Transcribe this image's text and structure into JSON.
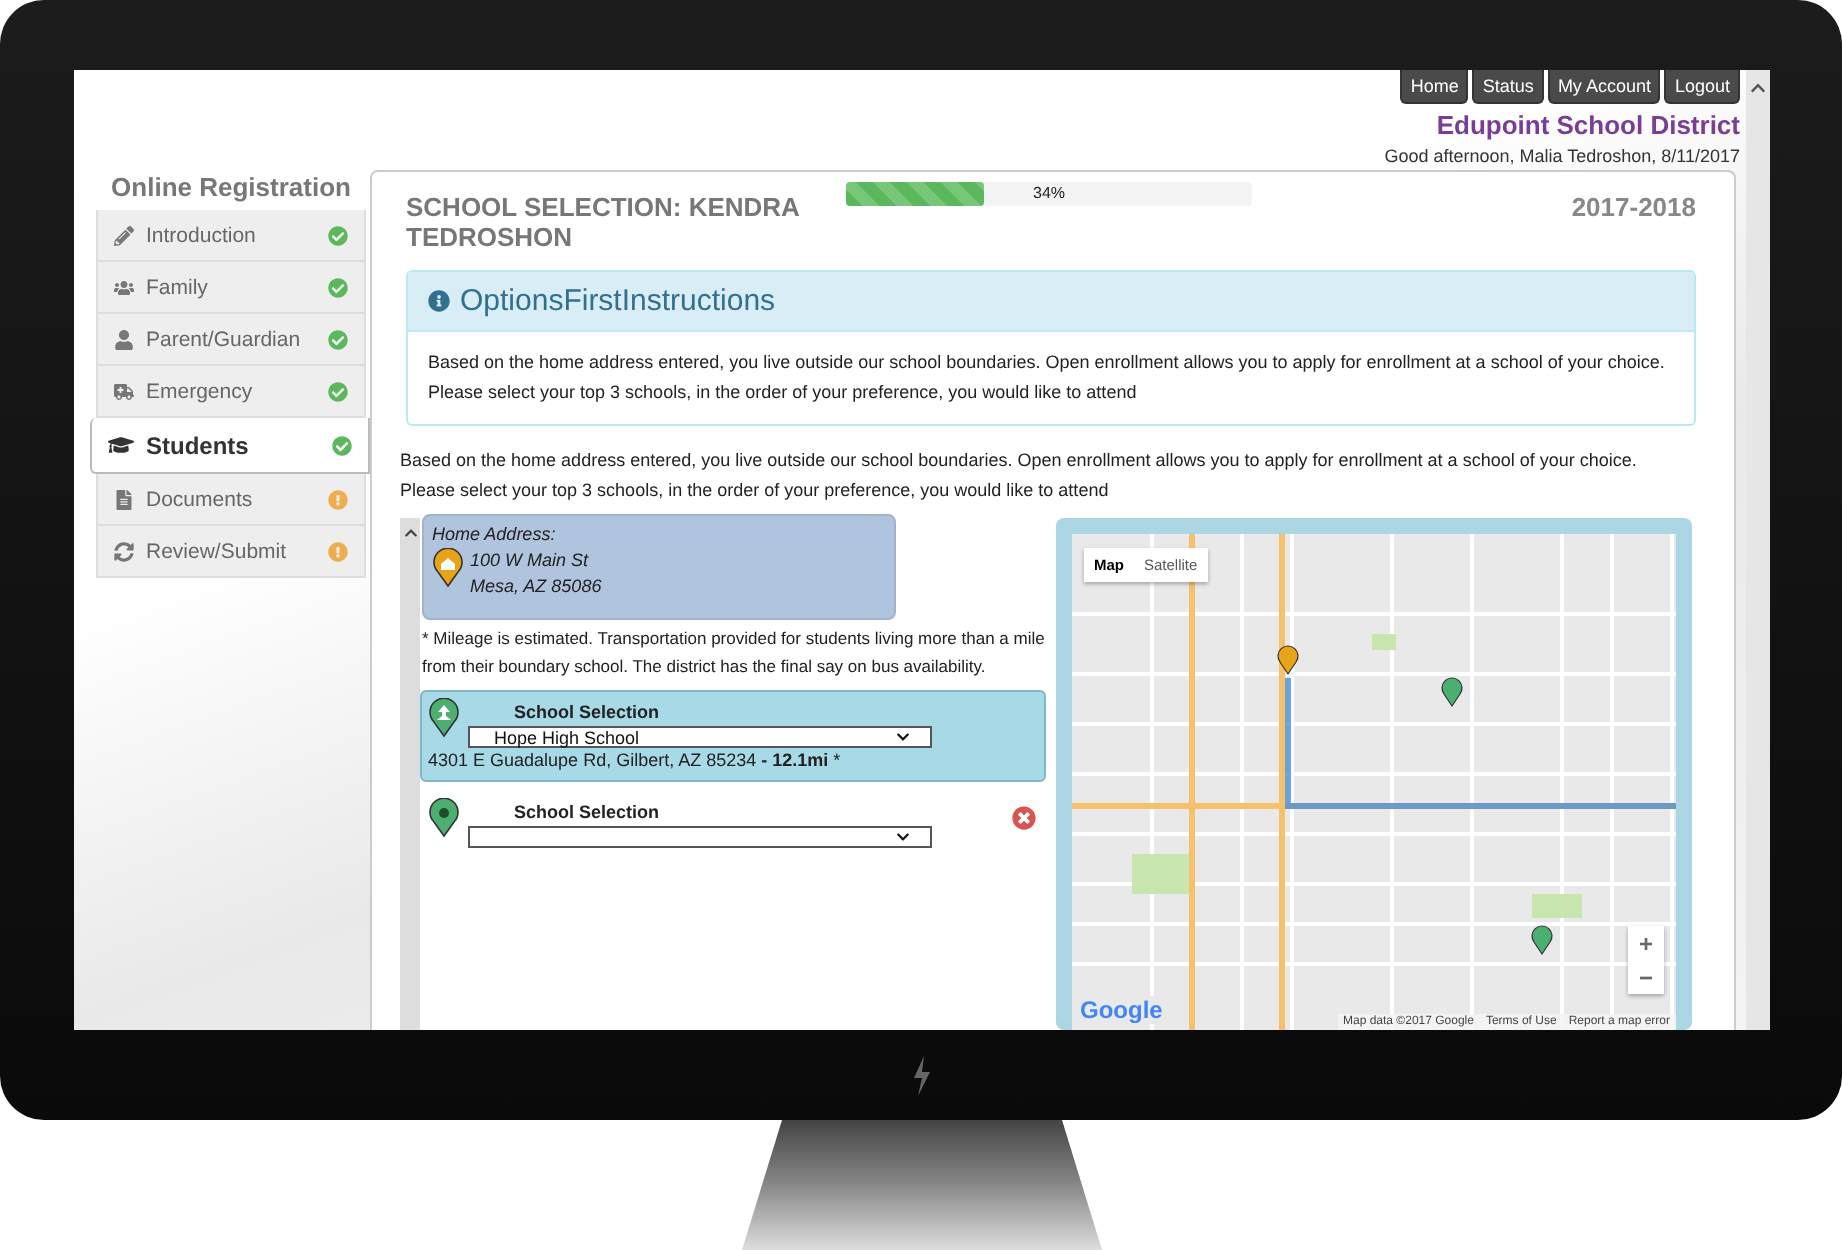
{
  "top_nav": [
    {
      "label": "Home"
    },
    {
      "label": "Status"
    },
    {
      "label": "My Account"
    },
    {
      "label": "Logout"
    }
  ],
  "district": "Edupoint School District",
  "greeting": "Good afternoon, Malia Tedroshon, 8/11/2017",
  "sidebar": {
    "title": "Online Registration",
    "items": [
      {
        "label": "Introduction",
        "complete": true,
        "selected": false
      },
      {
        "label": "Family",
        "complete": true,
        "selected": false
      },
      {
        "label": "Parent/Guardian",
        "complete": true,
        "selected": false
      },
      {
        "label": "Emergency",
        "complete": true,
        "selected": false
      },
      {
        "label": "Students",
        "complete": true,
        "selected": true
      },
      {
        "label": "Documents",
        "complete": false,
        "selected": false
      },
      {
        "label": "Review/Submit",
        "complete": false,
        "selected": false
      }
    ]
  },
  "page": {
    "title": "SCHOOL SELECTION: KENDRA TEDROSHON",
    "progress": {
      "level": 0.34,
      "label": "34%"
    },
    "year": "2017-2018"
  },
  "instructions": {
    "title": "OptionsFirstInstructions",
    "body": "Based on the home address entered, you live outside our school boundaries. Open enrollment allows you to apply for enrollment at a school of your choice. Please select your top 3 schools, in the order of your preference, you would like to attend"
  },
  "intro": "Based on the home address entered, you live outside our school boundaries. Open enrollment allows you to apply for enrollment at a school of your choice. Please select your top 3 schools, in the order of your preference, you would like to attend",
  "home_address": {
    "label": "Home Address:",
    "lines": [
      "100 W Main St",
      "Mesa, AZ 85086"
    ]
  },
  "mileage_note": "* Mileage is estimated. Transportation provided for students living more than a mile from their boundary school. The district has the final say on bus availability.",
  "selections": [
    {
      "label": "School Selection",
      "value": "Hope High School",
      "address": "4301 E Guadalupe Rd, Gilbert, AZ 85234 **- 12.1mi** *",
      "selected": true,
      "removable": false
    },
    {
      "label": "School Selection",
      "selected": false,
      "removable": true
    }
  ],
  "map": {
    "tabs": [
      {
        "label": "Map",
        "selected": true
      },
      {
        "label": "Satellite",
        "selected": false
      }
    ],
    "zoom_buttons": [
      "+",
      "−"
    ],
    "logo": "Google",
    "attribution": [
      "Map data ©2017 Google",
      "Terms of Use",
      "Report a map error"
    ]
  }
}
